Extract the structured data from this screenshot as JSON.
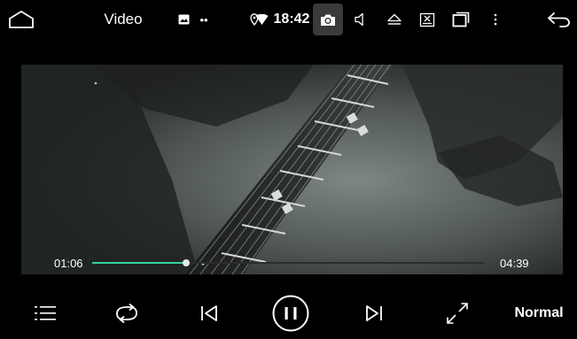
{
  "status_bar": {
    "title": "Video",
    "dots": "••",
    "clock": "18:42",
    "icons": [
      "home-icon",
      "image-icon",
      "location-icon",
      "wifi-icon",
      "camera-icon",
      "volume-icon",
      "eject-icon",
      "screenshot-icon",
      "recent-apps-icon",
      "more-icon",
      "back-icon"
    ]
  },
  "player": {
    "elapsed": "01:06",
    "duration": "04:39",
    "progress": 0.24
  },
  "controls": {
    "icons": [
      "playlist-icon",
      "repeat-icon",
      "previous-icon",
      "pause-icon",
      "next-icon",
      "fullscreen-icon"
    ],
    "mode_label": "Normal"
  },
  "colors": {
    "accent": "#34d39b",
    "background": "#000000"
  }
}
